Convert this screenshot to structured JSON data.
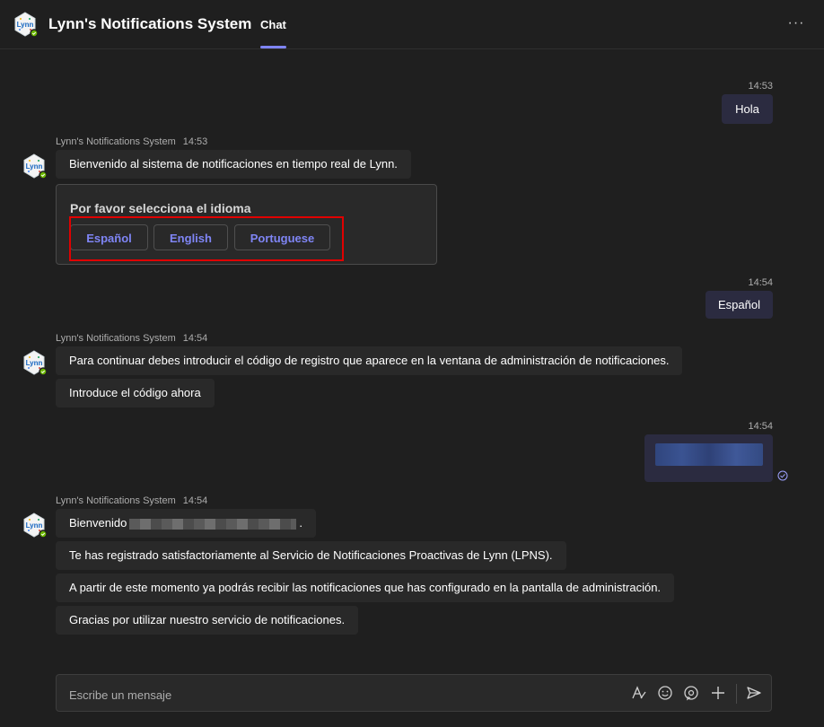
{
  "header": {
    "app_title": "Lynn's Notifications System",
    "tab_chat": "Chat",
    "more_label": "···"
  },
  "avatar_text": "Lynn",
  "messages": {
    "out1": {
      "time": "14:53",
      "text": "Hola"
    },
    "group1": {
      "sender": "Lynn's Notifications System",
      "time": "14:53",
      "welcome": "Bienvenido al sistema de notificaciones en tiempo real de Lynn.",
      "card": {
        "title": "Por favor selecciona el idioma",
        "buttons": [
          "Español",
          "English",
          "Portuguese"
        ]
      }
    },
    "out2": {
      "time": "14:54",
      "text": "Español"
    },
    "group2": {
      "sender": "Lynn's Notifications System",
      "time": "14:54",
      "lines": [
        "Para continuar debes introducir el código de registro que aparece en la ventana de administración de notificaciones.",
        "Introduce el código ahora"
      ]
    },
    "out3": {
      "time": "14:54"
    },
    "group3": {
      "sender": "Lynn's Notifications System",
      "time": "14:54",
      "greeting_prefix": "Bienvenido",
      "greeting_suffix": ".",
      "lines": [
        "Te has registrado satisfactoriamente al Servicio de Notificaciones Proactivas de Lynn (LPNS).",
        "A partir de este momento ya podrás recibir las notificaciones que has configurado en la pantalla de administración.",
        "Gracias por utilizar nuestro servicio de notificaciones."
      ]
    }
  },
  "composer": {
    "placeholder": "Escribe un mensaje",
    "icons": [
      "format-icon",
      "emoji-icon",
      "sticker-icon",
      "plus-icon",
      "send-icon"
    ]
  },
  "colors": {
    "background": "#1f1f1f",
    "incoming_bubble": "#292929",
    "outgoing_bubble": "#2b2b40",
    "accent": "#7f85f5",
    "highlight": "#e00000",
    "online": "#6bb700"
  }
}
